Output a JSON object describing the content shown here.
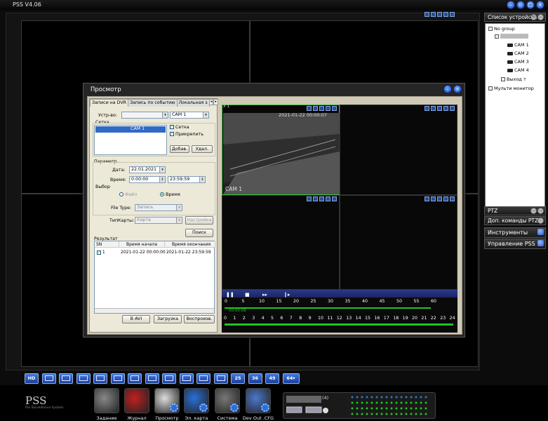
{
  "app": {
    "title": "PSS  V4.06",
    "logo": "PSS",
    "tagline": "Pro Surveillance System"
  },
  "right_panel": {
    "device_list_title": "Список устройств",
    "tree": [
      {
        "label": "No group",
        "indent": 0
      },
      {
        "label": "",
        "indent": 1
      },
      {
        "label": "CAM 1",
        "indent": 3
      },
      {
        "label": "CAM 2",
        "indent": 3
      },
      {
        "label": "CAM 3",
        "indent": 3
      },
      {
        "label": "CAM 4",
        "indent": 3
      },
      {
        "label": "Выход т",
        "indent": 2
      },
      {
        "label": "Мульти монитор",
        "indent": 0
      }
    ],
    "ptz": "PTZ",
    "ptz_extra": "Доп. команды PTZ",
    "tools": "Инструменты",
    "management": "Управление PSS"
  },
  "dialog": {
    "title": "Просмотр",
    "tabs": [
      "Записи на DVR",
      "Запись по событию",
      "Локальная з"
    ],
    "device_label": "Устр-во:",
    "device_value": "",
    "channel_value": "CAM 1",
    "grid_label": "Сетка",
    "grid_item": "CAM 1",
    "chk_grid": "Сетка",
    "chk_pin": "Прикрепить",
    "btn_add": "Добав.",
    "btn_delete": "Удал.",
    "param_label": "Параметр",
    "date_label": "Дата:",
    "date_value": "22.01.2021",
    "time_label": "Время:",
    "time_from": "0:00:00",
    "time_to": "23:59:59",
    "choice_label": "Выбор",
    "radio_file": "Файл",
    "radio_time": "Время",
    "filetype_label": "File Type:",
    "filetype_value": "Запись",
    "cardtype_label": "ТипКарты:",
    "cardtype_value": "Карта",
    "btn_settings": "Настройка",
    "btn_search": "Поиск",
    "result_label": "Результат",
    "result_columns": [
      "SN",
      "Время начала",
      "Время окончания"
    ],
    "result_rows": [
      {
        "sn": "1",
        "start": "2021-01-22 00:00:00",
        "end": "2021-01-22 23:59:59"
      }
    ],
    "btn_avi": "В AVI",
    "btn_download": "Загрузка",
    "btn_play": "Воспроизв.",
    "pb_window": "X 1",
    "pb_timestamp": "2021-01-22 00:00:07",
    "pb_cam": "CAM 1",
    "pb_elapsed": "00:00:08",
    "scale_minutes": [
      "0",
      "5",
      "10",
      "15",
      "20",
      "25",
      "30",
      "35",
      "40",
      "45",
      "50",
      "55",
      "60"
    ],
    "scale_hours": [
      "0",
      "1",
      "2",
      "3",
      "4",
      "5",
      "6",
      "7",
      "8",
      "9",
      "10",
      "11",
      "12",
      "13",
      "14",
      "15",
      "16",
      "17",
      "18",
      "19",
      "20",
      "21",
      "22",
      "23",
      "24"
    ]
  },
  "bottom_toolbar": {
    "layout_labels": [
      "HD",
      "",
      "",
      "",
      "",
      "",
      "",
      "",
      "",
      "",
      "",
      "",
      "25",
      "36",
      "49",
      "64▾"
    ],
    "apps": [
      "Задание",
      "Журнал",
      "Просмотр",
      "Эл. карта",
      "Система",
      "Dev Out .CFG"
    ],
    "status_count": "(4)"
  },
  "colors": {
    "accent_blue": "#2a5fcf",
    "green_bar": "#22c422",
    "selected_cell": "#3bbf3b"
  }
}
